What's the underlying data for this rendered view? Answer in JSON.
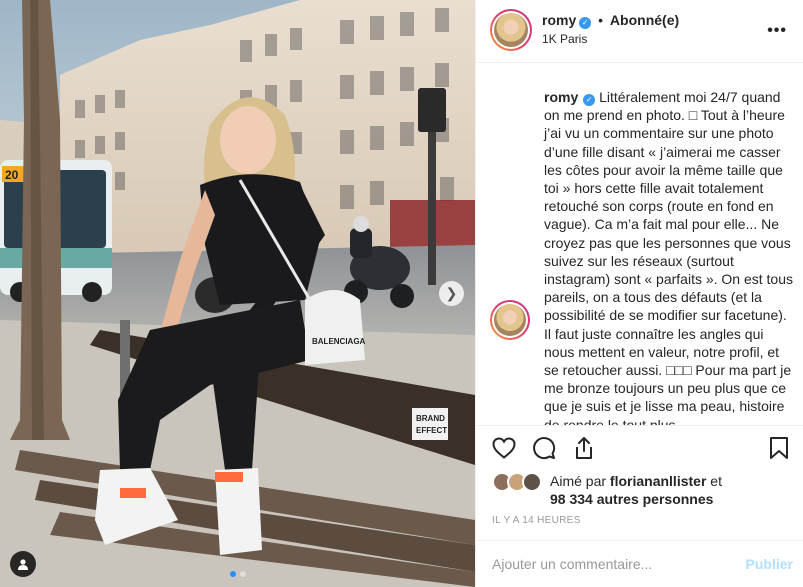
{
  "post": {
    "username": "romy",
    "separator": "•",
    "follow_status": "Abonné(e)",
    "location": "1K Paris",
    "more_icon": "more-horizontal-icon",
    "verified_icon": "verified-badge-icon",
    "verified_mark": "✓",
    "caption": "Littéralement moi 24/7 quand on me prend en photo. □ Tout à l’heure j’ai vu un commentaire sur une photo d’une fille disant « j’aimerai me casser les côtes pour avoir la même taille que toi » hors cette fille avait totalement retouché son corps (route en fond en vague). Ca m’a fait mal pour elle... Ne croyez pas que les personnes que vous suivez sur les réseaux (surtout instagram) sont « parfaits ». On est tous pareils, on a tous des défauts (et la possibilité de se modifier sur facetune). Il faut juste connaître les angles qui nous mettent en valeur, notre profil, et se retoucher aussi. □□□ Pour ma part je me bronze toujours un peu plus que ce que je suis et je lisse ma peau, histoire de rendre le tout plus",
    "likes_prefix": "Aimé par",
    "liked_by": "floriananllister",
    "likes_and": "et",
    "likes_count": "98 334 autres personnes",
    "timestamp": "IL Y A 14 HEURES",
    "comment_placeholder": "Ajouter un commentaire...",
    "post_label": "Publier",
    "carousel": {
      "count": 2,
      "active_index": 0
    },
    "colors": {
      "accent": "#3897f0",
      "post_disabled": "#b2dffc",
      "muted": "#999999"
    }
  },
  "photo": {
    "bus_sign": "20",
    "bench_sticker_line1": "BRAND",
    "bench_sticker_line2": "EFFECT",
    "bag_text": "BALENCIAGA"
  }
}
